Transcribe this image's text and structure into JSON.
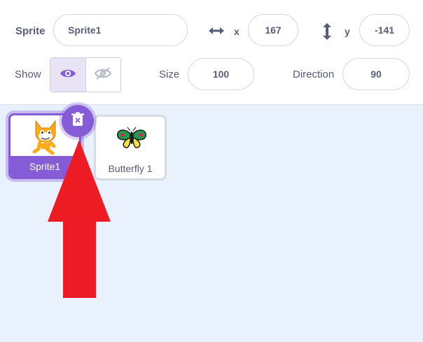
{
  "info": {
    "sprite_label": "Sprite",
    "sprite_name": "Sprite1",
    "x_label": "x",
    "x_value": "167",
    "y_label": "y",
    "y_value": "-141",
    "show_label": "Show",
    "size_label": "Size",
    "size_value": "100",
    "direction_label": "Direction",
    "direction_value": "90"
  },
  "sprites": [
    {
      "name": "Sprite1",
      "selected": true,
      "icon": "cat-sprite-icon"
    },
    {
      "name": "Butterfly 1",
      "selected": false,
      "icon": "butterfly-sprite-icon"
    }
  ],
  "colors": {
    "accent": "#855cd6",
    "annotation_arrow": "#ed1c24",
    "sprite_area_bg": "#e9f1fc"
  }
}
